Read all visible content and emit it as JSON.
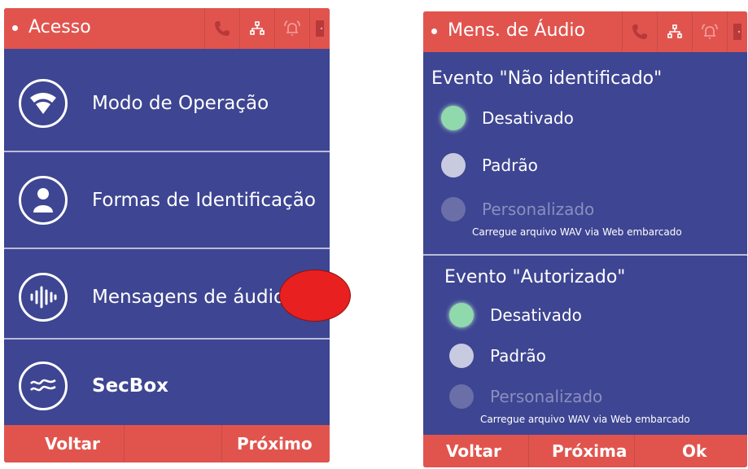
{
  "left_screen": {
    "title": "Acesso",
    "status_icons": [
      "phone-icon",
      "network-icon",
      "alarm-bell-icon",
      "door-icon"
    ],
    "menu_items": [
      {
        "label": "Modo de Operação",
        "icon": "wifi-fan-icon"
      },
      {
        "label": "Formas de Identificação",
        "icon": "person-icon"
      },
      {
        "label": "Mensagens de áudio",
        "icon": "audio-wave-icon"
      },
      {
        "label": "SecBox",
        "icon": "secbox-wave-icon"
      }
    ],
    "bottom_bar": {
      "back": "Voltar",
      "next": "Próximo"
    }
  },
  "right_screen": {
    "title": "Mens. de Áudio",
    "status_icons": [
      "phone-icon",
      "network-icon",
      "alarm-bell-icon",
      "door-icon"
    ],
    "sections": [
      {
        "title": "Evento \"Não identificado\"",
        "options": [
          {
            "label": "Desativado",
            "state": "selected"
          },
          {
            "label": "Padrão",
            "state": "unselected"
          },
          {
            "label": "Personalizado",
            "state": "disabled"
          }
        ],
        "hint": "Carregue arquivo WAV via Web embarcado"
      },
      {
        "title": "Evento \"Autorizado\"",
        "options": [
          {
            "label": "Desativado",
            "state": "selected"
          },
          {
            "label": "Padrão",
            "state": "unselected"
          },
          {
            "label": "Personalizado",
            "state": "disabled"
          }
        ],
        "hint": "Carregue arquivo WAV via Web embarcado"
      }
    ],
    "bottom_bar": {
      "back": "Voltar",
      "next": "Próxima",
      "ok": "Ok"
    }
  },
  "colors": {
    "background": "#3e4592",
    "header": "#e1544e",
    "selected_radio": "#8fd9ad",
    "marker": "#e8201f"
  }
}
